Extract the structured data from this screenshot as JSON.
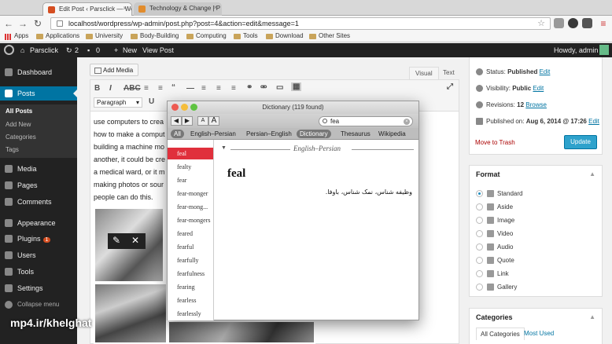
{
  "browser": {
    "tabs": [
      {
        "title": "Edit Post ‹ Parsclick — Wo",
        "active": true,
        "fav_color": "#d54e21"
      },
      {
        "title": "Technology & Change | P",
        "active": false,
        "fav_color": "#e28c2c"
      }
    ],
    "url": "localhost/wordpress/wp-admin/post.php?post=4&action=edit&message=1",
    "bookmarks": [
      "Apps",
      "Applications",
      "University",
      "Body-Building",
      "Computing",
      "Tools",
      "Download",
      "Other Sites"
    ]
  },
  "adminbar": {
    "site": "Parsclick",
    "updates": "2",
    "comments": "0",
    "new": "New",
    "view_post": "View Post",
    "howdy": "Howdy, admin"
  },
  "sidebar": {
    "items": [
      {
        "label": "Dashboard"
      },
      {
        "label": "Posts"
      },
      {
        "label": "Media"
      },
      {
        "label": "Pages"
      },
      {
        "label": "Comments"
      },
      {
        "label": "Appearance"
      },
      {
        "label": "Plugins",
        "badge": "1"
      },
      {
        "label": "Users"
      },
      {
        "label": "Tools"
      },
      {
        "label": "Settings"
      },
      {
        "label": "Collapse menu"
      }
    ],
    "sub": [
      "All Posts",
      "Add New",
      "Categories",
      "Tags"
    ]
  },
  "editor": {
    "add_media": "Add Media",
    "tab_visual": "Visual",
    "tab_text": "Text",
    "format": "Paragraph",
    "lines": [
      "use computers to crea",
      "how to make a comput",
      "building a machine mo",
      "another, it could be cre",
      "a medical ward, or it m",
      "making photos or sour",
      "people can do this."
    ]
  },
  "publish": {
    "status_label": "Status: ",
    "status": "Published",
    "visibility_label": "Visibility: ",
    "visibility": "Public",
    "revisions_label": "Revisions: ",
    "revisions": "12",
    "published_label": "Published on: ",
    "published": "Aug 6, 2014 @ 17:26",
    "edit": "Edit",
    "browse": "Browse",
    "trash": "Move to Trash",
    "update": "Update"
  },
  "format_box": {
    "title": "Format",
    "options": [
      "Standard",
      "Aside",
      "Image",
      "Video",
      "Audio",
      "Quote",
      "Link",
      "Gallery"
    ]
  },
  "categories_box": {
    "title": "Categories",
    "tab_all": "All Categories",
    "tab_used": "Most Used"
  },
  "dictionary": {
    "title": "Dictionary",
    "count": "(119 found)",
    "search": "fea",
    "font_small": "A",
    "font_large": "A",
    "scopes": [
      "All",
      "English–Persian",
      "Persian–English",
      "Dictionary",
      "Thesaurus",
      "Wikipedia"
    ],
    "words": [
      "feal",
      "fealty",
      "fear",
      "fear-monger",
      "fear-mong...",
      "fear-mongers",
      "feared",
      "fearful",
      "fearfully",
      "fearfulness",
      "fearing",
      "fearless",
      "fearlessly"
    ],
    "source": "English–Persian",
    "headword": "feal",
    "definition": "وظیفه شناس، نمک شناس، باوفا."
  },
  "watermark": "mp4.ir/khelghat"
}
